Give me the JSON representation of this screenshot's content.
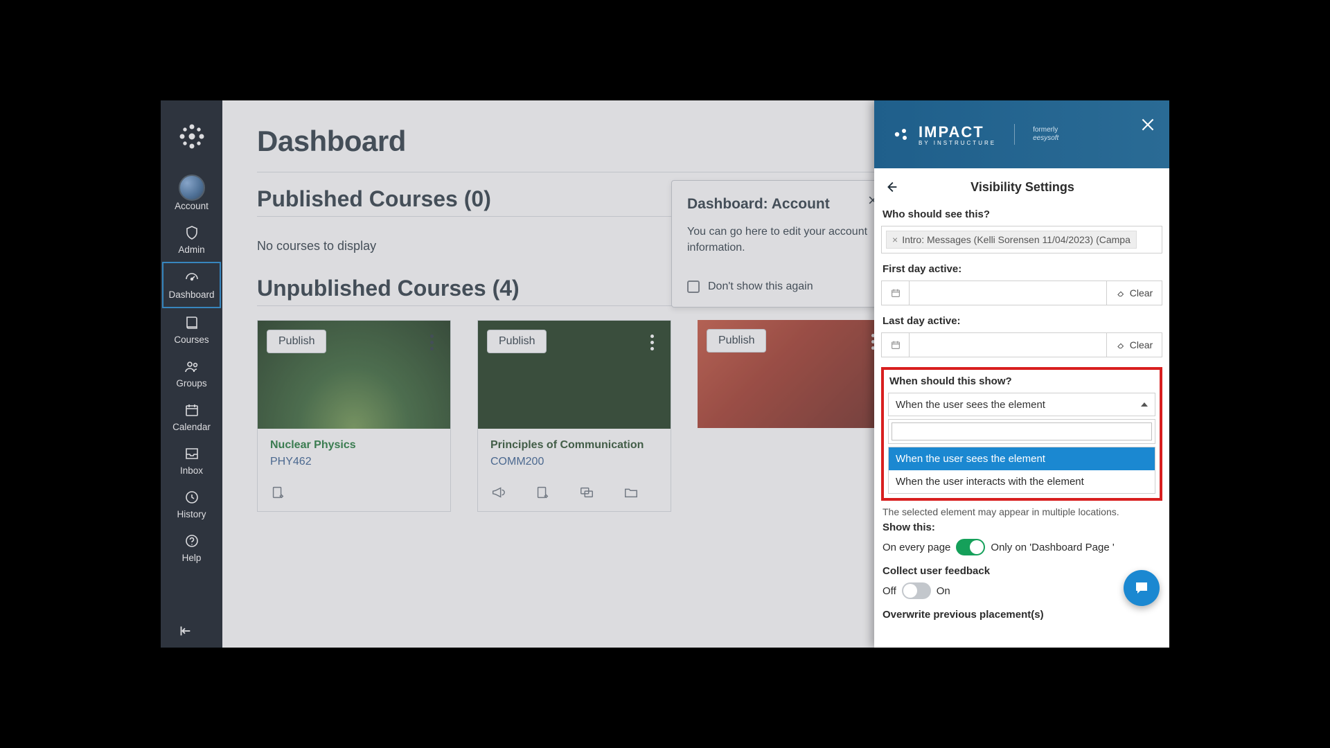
{
  "nav": {
    "account": "Account",
    "admin": "Admin",
    "dashboard": "Dashboard",
    "courses": "Courses",
    "groups": "Groups",
    "calendar": "Calendar",
    "inbox": "Inbox",
    "history": "History",
    "help": "Help"
  },
  "dashboard": {
    "title": "Dashboard",
    "published_title": "Published Courses (0)",
    "empty_text": "No courses to display",
    "unpublished_title": "Unpublished Courses (4)",
    "publish_btn": "Publish",
    "courses": [
      {
        "name": "Nuclear Physics",
        "code": "PHY462",
        "name_class": "green",
        "top": "forest",
        "icons": 1
      },
      {
        "name": "Principles of Communication",
        "code": "COMM200",
        "name_class": "olive",
        "top": "darkgreen",
        "icons": 4
      },
      {
        "name": "",
        "code": "",
        "name_class": "",
        "top": "books",
        "icons": 0
      },
      {
        "name": "",
        "code": "",
        "name_class": "",
        "top": "darkplum",
        "icons": 0
      }
    ]
  },
  "popover": {
    "title": "Dashboard: Account",
    "body": "You can go here to edit your account information.",
    "checkbox": "Don't show this again"
  },
  "panel": {
    "brand": "IMPACT",
    "brand_sub": "BY INSTRUCTURE",
    "formerly": "formerly",
    "formerly_name": "eesysoft",
    "title": "Visibility Settings",
    "who_label": "Who should see this?",
    "who_chip": "Intro: Messages (Kelli Sorensen 11/04/2023) (Campa",
    "first_day": "First day active:",
    "last_day": "Last day active:",
    "clear": "Clear",
    "when_label": "When should this show?",
    "when_selected": "When the user sees the element",
    "when_options": [
      "When the user sees the element",
      "When the user interacts with the element"
    ],
    "hint": "The selected element may appear in multiple locations.",
    "show_this": "Show this:",
    "toggle_left": "On every page",
    "toggle_right": "Only on 'Dashboard Page '",
    "collect_label": "Collect user feedback",
    "off": "Off",
    "on": "On",
    "overwrite": "Overwrite previous placement(s)"
  }
}
